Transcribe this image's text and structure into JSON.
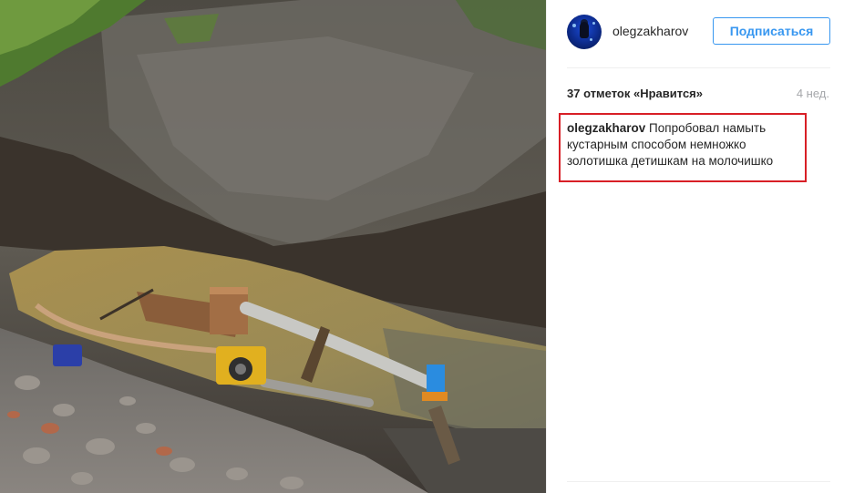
{
  "post": {
    "username": "olegzakharov",
    "follow_label": "Подписаться",
    "likes_text": "37 отметок «Нравится»",
    "time_text": "4 нед.",
    "caption_author": "olegzakharov",
    "caption_text": "Попробовал намыть кустарным способом немножко золотишка детишкам на молочишко"
  },
  "colors": {
    "accent": "#3897f0",
    "highlight_border": "#d81f26",
    "text": "#262626",
    "muted": "#a5a7aa"
  },
  "icons": {
    "avatar": "diver-avatar"
  }
}
